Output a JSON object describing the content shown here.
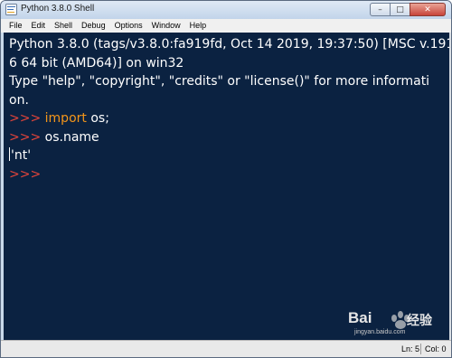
{
  "window": {
    "title": "Python 3.8.0 Shell",
    "buttons": {
      "minimize": "–",
      "maximize": "□",
      "close": "✕"
    }
  },
  "menu": [
    "File",
    "Edit",
    "Shell",
    "Debug",
    "Options",
    "Window",
    "Help"
  ],
  "shell": {
    "banner_1": "Python 3.8.0 (tags/v3.8.0:fa919fd, Oct 14 2019, 19:37:50) [MSC v.191",
    "banner_2": "6 64 bit (AMD64)] on win32",
    "banner_3": "Type \"help\", \"copyright\", \"credits\" or \"license()\" for more informati",
    "banner_4": "on.",
    "prompt": ">>> ",
    "line1_keyword": "import",
    "line1_rest": " os;",
    "line2_code": "os.name",
    "output": "'nt'"
  },
  "status": {
    "ln": "Ln: 5",
    "col": "Col: 0"
  },
  "watermark": {
    "brand": "Bai",
    "brand2": "经验",
    "sub": "jingyan.baidu.com"
  },
  "colors": {
    "editor_bg": "#0b2241",
    "prompt": "#e2443a",
    "keyword": "#f4961a",
    "text": "#ffffff"
  },
  "icons": {
    "app": "python-idle-icon"
  }
}
